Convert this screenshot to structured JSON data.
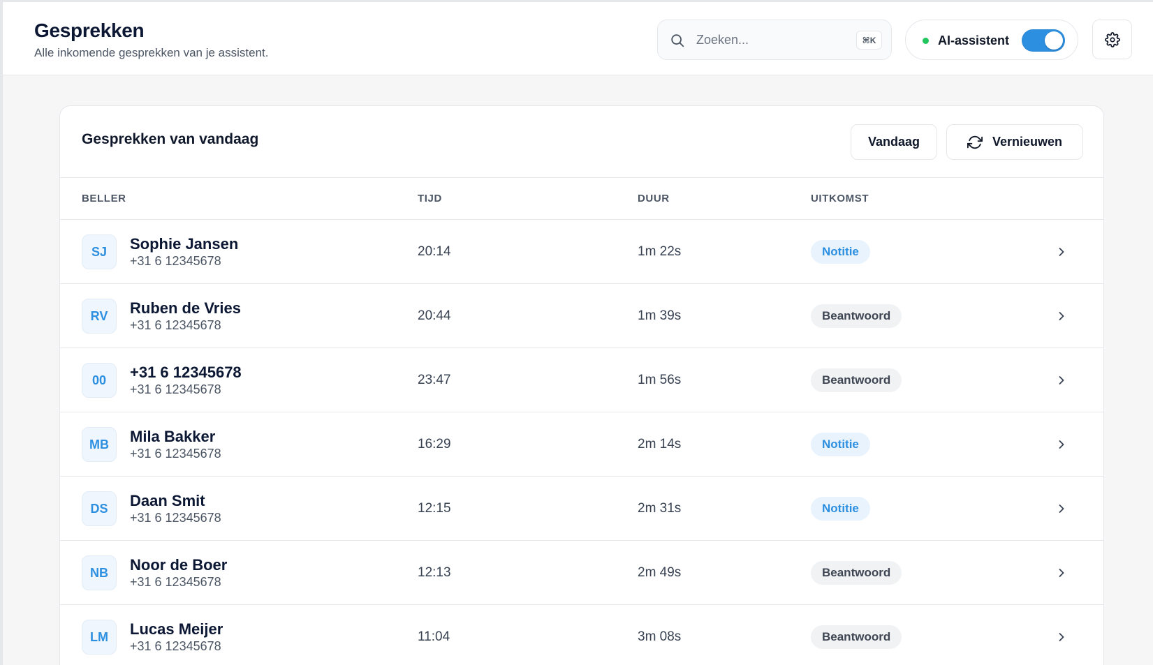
{
  "header": {
    "title": "Gesprekken",
    "subtitle": "Alle inkomende gesprekken van je assistent.",
    "search": {
      "placeholder": "Zoeken...",
      "shortcut": "⌘K"
    },
    "ai_toggle": {
      "label": "AI-assistent",
      "enabled": true,
      "status_color": "#22c55e",
      "accent_color": "#2d8fe0"
    },
    "settings_icon": "gear-icon"
  },
  "card": {
    "title": "Gesprekken van vandaag",
    "today_label": "Vandaag",
    "refresh_label": "Vernieuwen",
    "columns": {
      "caller": "BELLER",
      "time": "TIJD",
      "duration": "DUUR",
      "outcome": "UITKOMST"
    },
    "rows": [
      {
        "initials": "SJ",
        "name": "Sophie Jansen",
        "phone": "+31 6 12345678",
        "time": "20:14",
        "duration": "1m 22s",
        "outcome": "Notitie",
        "outcome_type": "note"
      },
      {
        "initials": "RV",
        "name": "Ruben de Vries",
        "phone": "+31 6 12345678",
        "time": "20:44",
        "duration": "1m 39s",
        "outcome": "Beantwoord",
        "outcome_type": "answered"
      },
      {
        "initials": "00",
        "name": "+31 6 12345678",
        "phone": "+31 6 12345678",
        "time": "23:47",
        "duration": "1m 56s",
        "outcome": "Beantwoord",
        "outcome_type": "answered"
      },
      {
        "initials": "MB",
        "name": "Mila Bakker",
        "phone": "+31 6 12345678",
        "time": "16:29",
        "duration": "2m 14s",
        "outcome": "Notitie",
        "outcome_type": "note"
      },
      {
        "initials": "DS",
        "name": "Daan Smit",
        "phone": "+31 6 12345678",
        "time": "12:15",
        "duration": "2m 31s",
        "outcome": "Notitie",
        "outcome_type": "note"
      },
      {
        "initials": "NB",
        "name": "Noor de Boer",
        "phone": "+31 6 12345678",
        "time": "12:13",
        "duration": "2m 49s",
        "outcome": "Beantwoord",
        "outcome_type": "answered"
      },
      {
        "initials": "LM",
        "name": "Lucas Meijer",
        "phone": "+31 6 12345678",
        "time": "11:04",
        "duration": "3m 08s",
        "outcome": "Beantwoord",
        "outcome_type": "answered"
      }
    ]
  }
}
